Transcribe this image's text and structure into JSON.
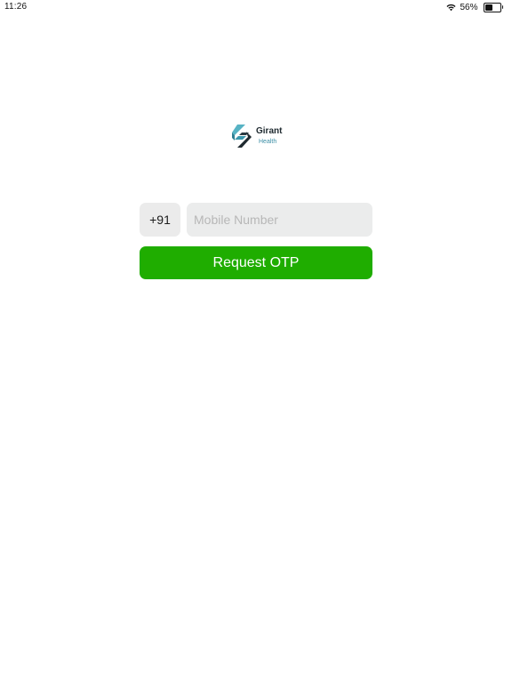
{
  "status_bar": {
    "time": "11:26",
    "battery_percent": "56%",
    "battery_level": 0.56,
    "wifi_icon": "wifi-icon",
    "battery_icon": "battery-icon"
  },
  "logo": {
    "name": "Girant",
    "subtitle": "Health",
    "icon": "girant-logo-icon"
  },
  "form": {
    "country_code": "+91",
    "mobile_placeholder": "Mobile Number",
    "mobile_value": "",
    "submit_label": "Request OTP"
  },
  "colors": {
    "primary_button": "#1fad00",
    "field_background": "#ebebeb",
    "logo_teal": "#3c8fa6",
    "logo_dark": "#1f2a30"
  }
}
